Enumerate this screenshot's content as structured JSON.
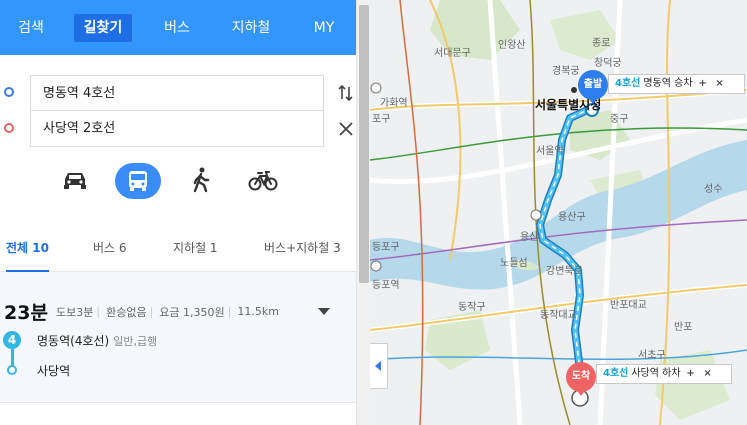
{
  "nav": {
    "tabs": [
      {
        "label": "검색"
      },
      {
        "label": "길찾기"
      },
      {
        "label": "버스"
      },
      {
        "label": "지하철"
      },
      {
        "label": "MY"
      }
    ]
  },
  "route": {
    "start": "명동역 4호선",
    "end": "사당역 2호선"
  },
  "filters": [
    {
      "label": "전체 10"
    },
    {
      "label": "버스 6"
    },
    {
      "label": "지하철 1"
    },
    {
      "label": "버스+지하철 3"
    }
  ],
  "result": {
    "duration": "23분",
    "walk": "도보3분",
    "transfer": "환승없음",
    "fare": "요금 1,350원",
    "distance": "11.5km",
    "line_badge": "4",
    "board_station": "명동역(4호선)",
    "board_service": "일반,급행",
    "alight_station": "사당역"
  },
  "map": {
    "labels": {
      "seodaemun": "서대문구",
      "inwangsan": "인왕산",
      "jongno": "종로",
      "gyeongbokgung": "경복궁",
      "changdeokgung": "창덕궁",
      "gahwa": "가화역",
      "seoul_city": "서울특별시청",
      "jung_gu": "중구",
      "seoul_station": "서울역",
      "seongsu": "성수",
      "yongsan": "용산구",
      "yongsan_st": "용산",
      "nodeul": "노들섬",
      "gangbyeon": "강변북로",
      "deungpo": "등포구",
      "deungpo_st": "등포역",
      "dongjak": "동작구",
      "dongjak_bridge": "동작대교",
      "banpo_bridge": "반포대교",
      "banpo": "반포",
      "seocho": "서초구",
      "pogu": "포구"
    },
    "start_pin": "출발",
    "end_pin": "도착",
    "start_callout": {
      "line": "4호선",
      "text": "명동역 승차"
    },
    "end_callout": {
      "line": "4호선",
      "text": "사당역 하차"
    },
    "route_color": "#2aa8e0",
    "river_color": "#7ab8d8"
  },
  "icons": {
    "modes": [
      "car-icon",
      "bus-icon",
      "walk-icon",
      "bicycle-icon"
    ],
    "swap": "swap-icon",
    "clear": "close-icon",
    "collapse": "chevron-left-icon"
  }
}
